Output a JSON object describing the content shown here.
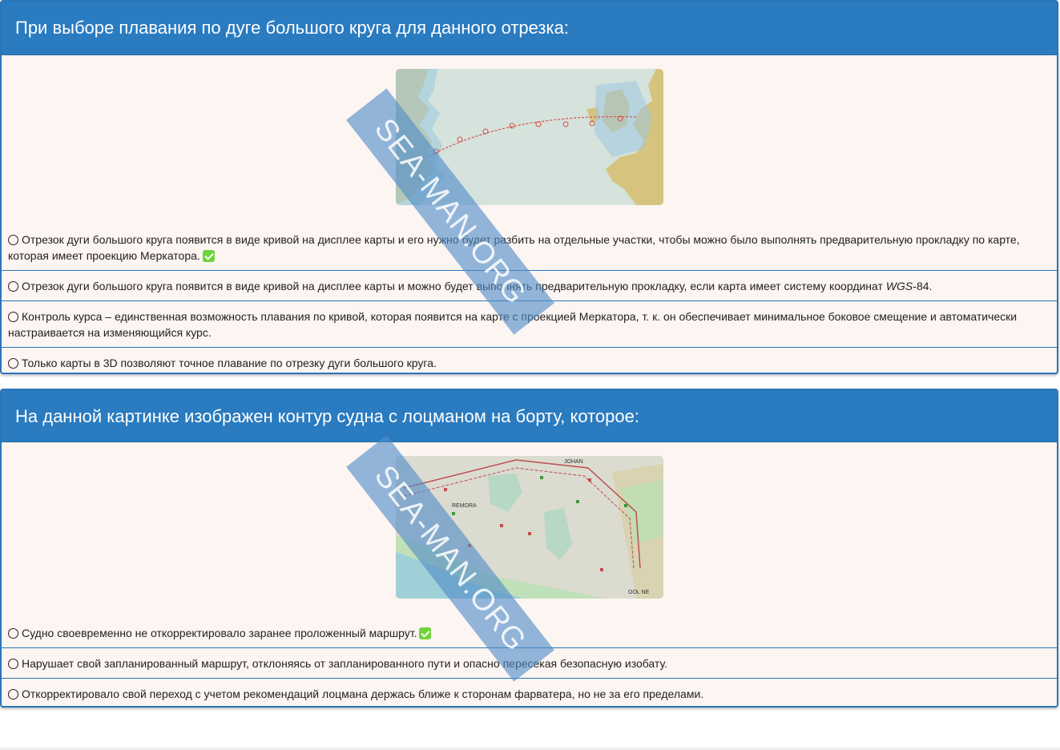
{
  "questions": [
    {
      "title": "При выборе плавания по дуге большого круга для данного отрезка:",
      "answers": [
        {
          "text": "Отрезок дуги большого круга появится в виде кривой на дисплее карты и его нужно будет разбить на отдельные участки, чтобы можно было выполнять предварительную прокладку по карте, которая имеет проекцию Меркатора.",
          "correct": true
        },
        {
          "text_before": "Отрезок дуги большого круга появится в виде кривой на дисплее карты и можно будет выполнять предварительную прокладку, если карта имеет систему координат ",
          "text_em": "WGS",
          "text_after": "-84.",
          "correct": false
        },
        {
          "text": "Контроль курса – единственная возможность плавания по кривой, которая появится на карте с проекцией Меркатора, т. к. он обеспечивает минимальное боковое смещение и автоматически настраивается на изменяющийся курс.",
          "correct": false
        },
        {
          "text": "Только карты в 3D позволяют точное плавание по отрезку дуги большого круга.",
          "correct": false
        }
      ]
    },
    {
      "title": "На данной картинке изображен контур судна с лоцманом на борту, которое:",
      "answers": [
        {
          "text": "Судно своевременно не откорректировало заранее проложенный маршрут.",
          "correct": true
        },
        {
          "text": "Нарушает свой запланированный маршрут, отклоняясь от запланированного пути и опасно пересекая безопасную изобату.",
          "correct": false
        },
        {
          "text": "Откорректировало свой переход с учетом рекомендаций лоцмана держась ближе к сторонам фарватера, но не за его пределами.",
          "correct": false
        }
      ]
    }
  ],
  "map2_labels": {
    "top": "JOHAN",
    "left": "REMORA",
    "right": "OOL NE"
  },
  "watermark": "SEA-MAN.ORG",
  "colors": {
    "header_bg": "#2a7bc0",
    "card_border": "#2a74b8",
    "card_bg": "#fcf5f2",
    "check_green": "#6fd43a"
  },
  "icons": {
    "radio": "radio-unchecked-icon",
    "correct": "check-mark-icon"
  }
}
